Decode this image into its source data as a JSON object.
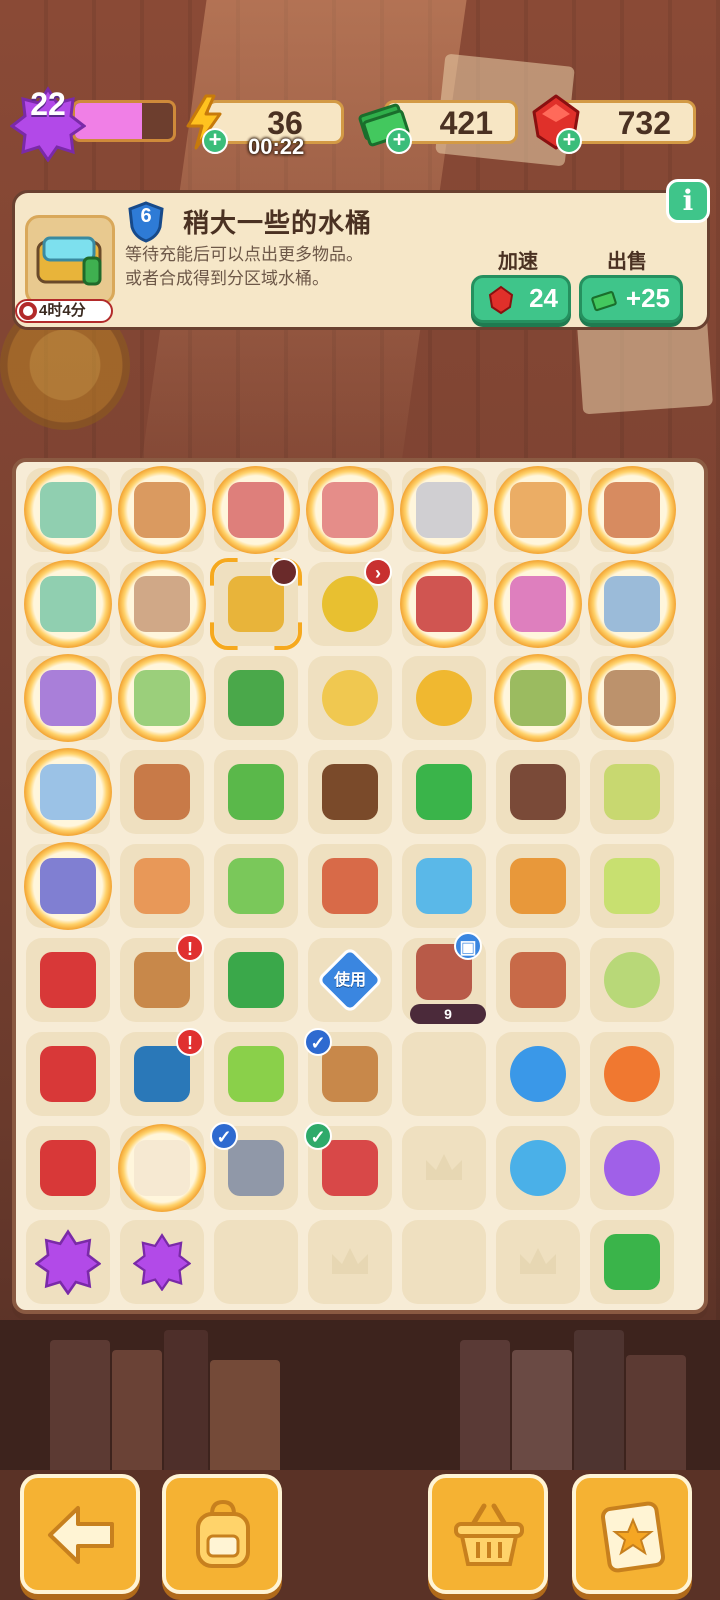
{
  "top": {
    "level": "22",
    "xp_fraction": 0.68,
    "energy": "36",
    "energy_timer": "00:22",
    "cash": "421",
    "gems": "732"
  },
  "info_panel": {
    "level": "6",
    "title": "稍大一些的水桶",
    "description": "等待充能后可以点出更多物品。\n或者合成得到分区域水桶。",
    "timer": "4时4分",
    "speedup_label": "加速",
    "speedup_cost": "24",
    "sell_label": "出售",
    "sell_value": "+25"
  },
  "board": {
    "use_label": "使用",
    "tv_count": "9",
    "cells": [
      [
        "glow-supplies",
        "glow-lumber",
        "glow-machine",
        "glow-toolbox",
        "glow-workbench",
        "glow-bakery",
        "glow-shrine"
      ],
      [
        "glow-supplies",
        "glow-pottery",
        "bucket-selected",
        "bucket-timer",
        "glow-redtool",
        "glow-flowerpot",
        "glow-map"
      ],
      [
        "glow-truck",
        "glow-tree",
        "bonsai",
        "bucket",
        "hat",
        "glow-bush",
        "glow-desk"
      ],
      [
        "glow-camper",
        "crate-pile",
        "brush",
        "plunger",
        "cash-pile",
        "envelopes",
        "spray-bottle"
      ],
      [
        "glow-goggles",
        "bag",
        "broom",
        "camera",
        "scissors",
        "binoculars",
        "lotion"
      ],
      [
        "gloves",
        "chest-alert",
        "brush-green",
        "use-ticket",
        "tv-locked",
        "hourglass",
        "melon"
      ],
      [
        "gloves",
        "bluechest-alert",
        "scraper",
        "telescope-check",
        "empty",
        "energy-blue",
        "energy-orange"
      ],
      [
        "gloves",
        "glow-cat",
        "rake-check",
        "shears-check",
        "empty-crown",
        "energy-blue-small",
        "energy-purple"
      ],
      [
        "star-purple",
        "star-purple-small",
        "empty",
        "empty-crown",
        "empty",
        "empty-crown",
        "cash-stack"
      ]
    ]
  },
  "colors": {
    "accent_green": "#3fc58a",
    "gold": "#f5b233",
    "xp_pink": "#f07fe6",
    "gem_red": "#e0302a"
  },
  "icons": {
    "level": "purple-star-icon",
    "energy": "lightning-icon",
    "cash": "cash-stack-icon",
    "gems": "ruby-icon",
    "info": "info-icon",
    "back": "arrow-left-icon",
    "bag": "backpack-icon",
    "shop": "basket-icon",
    "tasks": "clipboard-star-icon"
  }
}
